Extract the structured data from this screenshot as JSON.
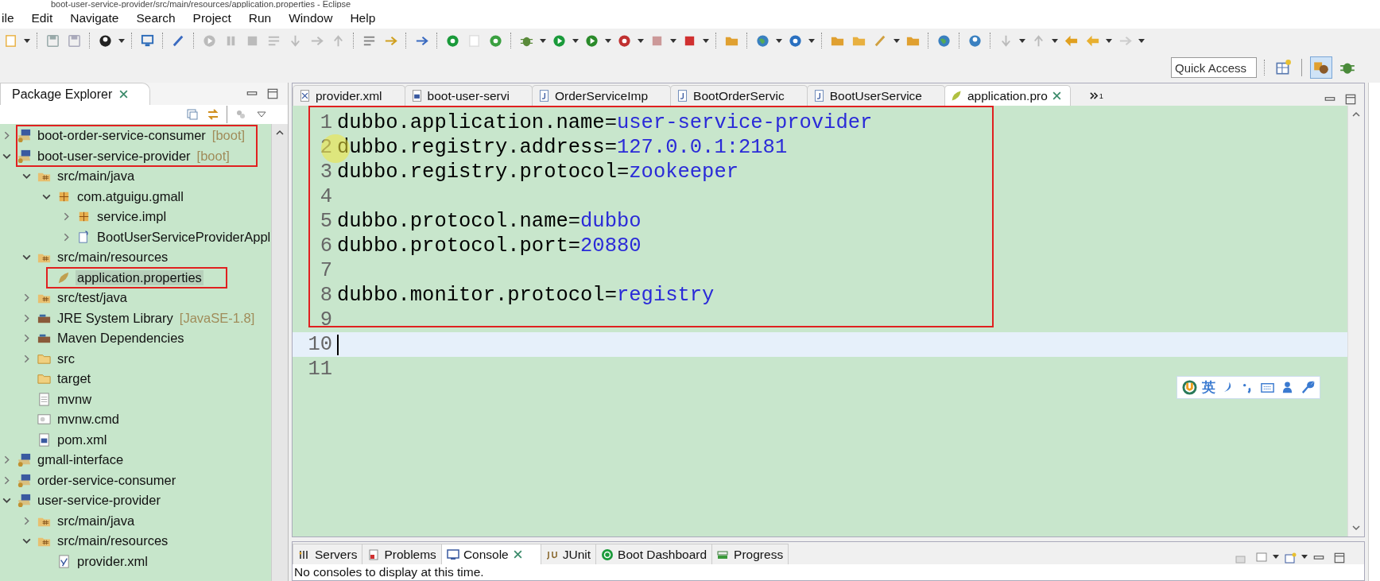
{
  "window": {
    "title": "boot-user-service-provider/src/main/resources/application.properties - Eclipse"
  },
  "menu": [
    "ile",
    "Edit",
    "Navigate",
    "Search",
    "Project",
    "Run",
    "Window",
    "Help"
  ],
  "quick_access": {
    "placeholder": "Quick Access"
  },
  "package_explorer": {
    "title": "Package Explorer",
    "items": [
      {
        "label": "boot-order-service-consumer",
        "decoration": "[boot]",
        "kind": "project",
        "expanded": false,
        "selected": false,
        "boxed": true
      },
      {
        "label": "boot-user-service-provider",
        "decoration": "[boot]",
        "kind": "project",
        "expanded": true,
        "selected": false,
        "boxed": true,
        "children": [
          {
            "label": "src/main/java",
            "kind": "source-folder",
            "expanded": true,
            "selected": false,
            "children": [
              {
                "label": "com.atguigu.gmall",
                "kind": "package",
                "expanded": true,
                "selected": false,
                "children": [
                  {
                    "label": "service.impl",
                    "kind": "package",
                    "expanded": false,
                    "selected": false
                  },
                  {
                    "label": "BootUserServiceProviderAppl",
                    "kind": "java-file",
                    "expanded": false,
                    "selected": false
                  }
                ]
              }
            ]
          },
          {
            "label": "src/main/resources",
            "kind": "source-folder",
            "expanded": true,
            "selected": false,
            "children": [
              {
                "label": "application.properties",
                "kind": "properties-file",
                "selected": true,
                "boxed": true
              }
            ]
          },
          {
            "label": "src/test/java",
            "kind": "source-folder",
            "expanded": false,
            "selected": false
          },
          {
            "label": "JRE System Library",
            "decoration": "[JavaSE-1.8]",
            "kind": "library",
            "expanded": false,
            "selected": false
          },
          {
            "label": "Maven Dependencies",
            "kind": "library",
            "expanded": false,
            "selected": false
          },
          {
            "label": "src",
            "kind": "folder",
            "expanded": false,
            "selected": false
          },
          {
            "label": "target",
            "kind": "folder",
            "selected": false
          },
          {
            "label": "mvnw",
            "kind": "text-file",
            "selected": false
          },
          {
            "label": "mvnw.cmd",
            "kind": "cmd-file",
            "selected": false
          },
          {
            "label": "pom.xml",
            "kind": "maven-file",
            "selected": false
          }
        ]
      },
      {
        "label": "gmall-interface",
        "kind": "project",
        "expanded": false,
        "selected": false
      },
      {
        "label": "order-service-consumer",
        "kind": "project",
        "expanded": false,
        "selected": false
      },
      {
        "label": "user-service-provider",
        "kind": "project",
        "expanded": true,
        "selected": false,
        "children": [
          {
            "label": "src/main/java",
            "kind": "source-folder",
            "expanded": false,
            "selected": false
          },
          {
            "label": "src/main/resources",
            "kind": "source-folder",
            "expanded": true,
            "selected": false,
            "children": [
              {
                "label": "provider.xml",
                "kind": "xml-file",
                "selected": false
              }
            ]
          }
        ]
      }
    ]
  },
  "editor": {
    "tabs": [
      {
        "label": "provider.xml",
        "kind": "xml",
        "selected": false
      },
      {
        "label": "boot-user-servi",
        "kind": "maven",
        "selected": false
      },
      {
        "label": "OrderServiceImp",
        "kind": "java",
        "selected": false
      },
      {
        "label": "BootOrderServic",
        "kind": "java",
        "selected": false
      },
      {
        "label": "BootUserService",
        "kind": "java",
        "selected": false
      },
      {
        "label": "application.pro",
        "kind": "properties",
        "selected": true
      }
    ],
    "overflow_count": "1",
    "highlighted": true,
    "lines": [
      {
        "number": "1",
        "key": "dubbo.application.name",
        "separator": "=",
        "value": "user-service-provider",
        "current": false
      },
      {
        "number": "2",
        "key": "dubbo.registry.address",
        "separator": "=",
        "value": "127.0.0.1:2181",
        "current": false
      },
      {
        "number": "3",
        "key": "dubbo.registry.protocol",
        "separator": "=",
        "value": "zookeeper",
        "current": false
      },
      {
        "number": "4",
        "current": false
      },
      {
        "number": "5",
        "key": "dubbo.protocol.name",
        "separator": "=",
        "value": "dubbo",
        "current": false
      },
      {
        "number": "6",
        "key": "dubbo.protocol.port",
        "separator": "=",
        "value": "20880",
        "current": false
      },
      {
        "number": "7",
        "current": false
      },
      {
        "number": "8",
        "key": "dubbo.monitor.protocol",
        "separator": "=",
        "value": "registry",
        "current": false
      },
      {
        "number": "9",
        "current": false
      },
      {
        "number": "10",
        "current": true
      },
      {
        "number": "11",
        "current": false
      }
    ],
    "ime_bar": {
      "label": "英"
    }
  },
  "bottom_panel": {
    "tabs": [
      {
        "label": "Servers",
        "kind": "servers",
        "selected": false
      },
      {
        "label": "Problems",
        "kind": "problems",
        "selected": false
      },
      {
        "label": "Console",
        "kind": "console",
        "selected": true
      },
      {
        "label": "JUnit",
        "kind": "junit",
        "selected": false
      },
      {
        "label": "Boot Dashboard",
        "kind": "boot",
        "selected": false
      },
      {
        "label": "Progress",
        "kind": "progress",
        "selected": false
      }
    ],
    "message": "No consoles to display at this time."
  }
}
